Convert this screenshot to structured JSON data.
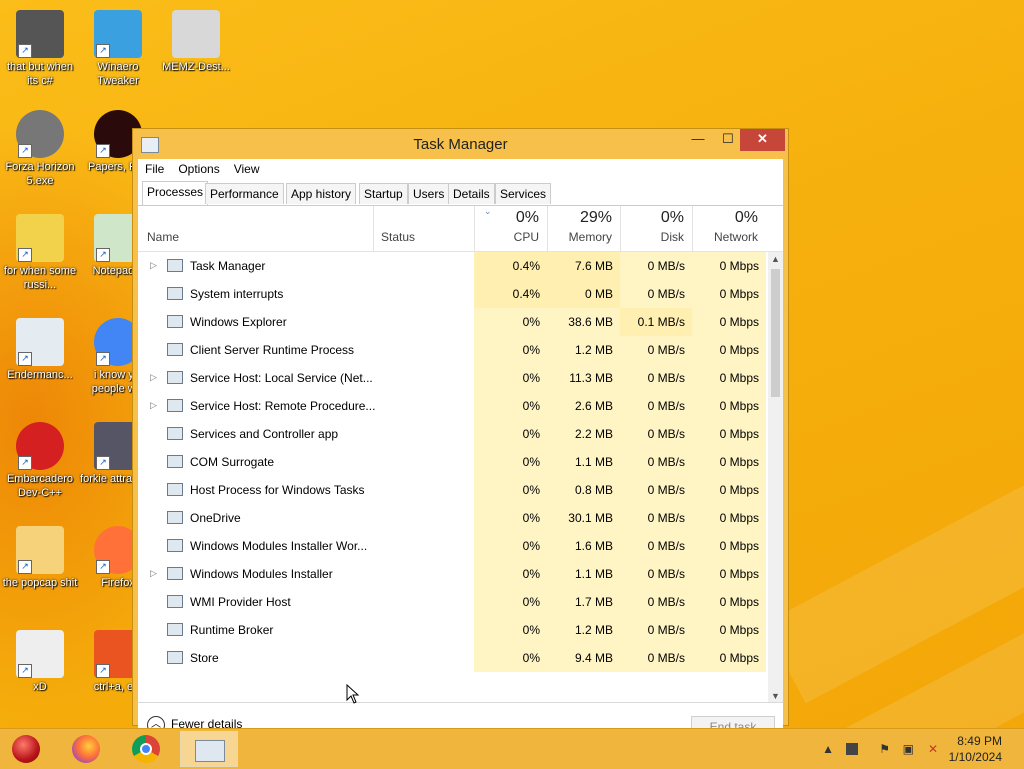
{
  "desktop": {
    "icons": [
      {
        "label": "that but when its c#",
        "icon": "stack-windows-icon"
      },
      {
        "label": "Winaero Tweaker",
        "icon": "winaero-icon"
      },
      {
        "label": "MEMZ-Dest...",
        "icon": "recycle-bin-icon"
      },
      {
        "label": "Forza Horizon 5.exe",
        "icon": "flash-icon"
      },
      {
        "label": "Papers, Pl...",
        "icon": "papers-please-icon"
      },
      {
        "label": "for when some russi...",
        "icon": "de-icon"
      },
      {
        "label": "Notepad...",
        "icon": "notepad-icon"
      },
      {
        "label": "Endermanc...",
        "icon": "window-icon"
      },
      {
        "label": "i know y... people w...",
        "icon": "chrome-icon"
      },
      {
        "label": "Embarcadero Dev-C++",
        "icon": "devcpp-icon"
      },
      {
        "label": "forkie attracta...",
        "icon": "gears-icon"
      },
      {
        "label": "the popcap shit",
        "icon": "popcap-icon"
      },
      {
        "label": "Firefox",
        "icon": "firefox-icon"
      },
      {
        "label": "xD",
        "icon": "hxd-icon"
      },
      {
        "label": "ctrl+a, e...",
        "icon": "ubuntu-icon"
      }
    ]
  },
  "window": {
    "title": "Task Manager",
    "minimize": "—",
    "maximize": "☐",
    "close": "✕",
    "menu": [
      "File",
      "Options",
      "View"
    ],
    "tabs": [
      "Processes",
      "Performance",
      "App history",
      "Startup",
      "Users",
      "Details",
      "Services"
    ],
    "active_tab": "Processes",
    "columns": {
      "name": "Name",
      "status": "Status",
      "cpu": {
        "pct": "0%",
        "label": "CPU"
      },
      "memory": {
        "pct": "29%",
        "label": "Memory"
      },
      "disk": {
        "pct": "0%",
        "label": "Disk"
      },
      "network": {
        "pct": "0%",
        "label": "Network"
      }
    },
    "processes": [
      {
        "name": "Task Manager",
        "expandable": true,
        "cpu": "0.4%",
        "memory": "7.6 MB",
        "disk": "0 MB/s",
        "network": "0 Mbps"
      },
      {
        "name": "System interrupts",
        "expandable": false,
        "cpu": "0.4%",
        "memory": "0 MB",
        "disk": "0 MB/s",
        "network": "0 Mbps"
      },
      {
        "name": "Windows Explorer",
        "expandable": false,
        "cpu": "0%",
        "memory": "38.6 MB",
        "disk": "0.1 MB/s",
        "network": "0 Mbps"
      },
      {
        "name": "Client Server Runtime Process",
        "expandable": false,
        "cpu": "0%",
        "memory": "1.2 MB",
        "disk": "0 MB/s",
        "network": "0 Mbps"
      },
      {
        "name": "Service Host: Local Service (Net...",
        "expandable": true,
        "cpu": "0%",
        "memory": "11.3 MB",
        "disk": "0 MB/s",
        "network": "0 Mbps"
      },
      {
        "name": "Service Host: Remote Procedure...",
        "expandable": true,
        "cpu": "0%",
        "memory": "2.6 MB",
        "disk": "0 MB/s",
        "network": "0 Mbps"
      },
      {
        "name": "Services and Controller app",
        "expandable": false,
        "cpu": "0%",
        "memory": "2.2 MB",
        "disk": "0 MB/s",
        "network": "0 Mbps"
      },
      {
        "name": "COM Surrogate",
        "expandable": false,
        "cpu": "0%",
        "memory": "1.1 MB",
        "disk": "0 MB/s",
        "network": "0 Mbps"
      },
      {
        "name": "Host Process for Windows Tasks",
        "expandable": false,
        "cpu": "0%",
        "memory": "0.8 MB",
        "disk": "0 MB/s",
        "network": "0 Mbps"
      },
      {
        "name": "OneDrive",
        "expandable": false,
        "cpu": "0%",
        "memory": "30.1 MB",
        "disk": "0 MB/s",
        "network": "0 Mbps"
      },
      {
        "name": "Windows Modules Installer Wor...",
        "expandable": false,
        "cpu": "0%",
        "memory": "1.6 MB",
        "disk": "0 MB/s",
        "network": "0 Mbps"
      },
      {
        "name": "Windows Modules Installer",
        "expandable": true,
        "cpu": "0%",
        "memory": "1.1 MB",
        "disk": "0 MB/s",
        "network": "0 Mbps"
      },
      {
        "name": "WMI Provider Host",
        "expandable": false,
        "cpu": "0%",
        "memory": "1.7 MB",
        "disk": "0 MB/s",
        "network": "0 Mbps"
      },
      {
        "name": "Runtime Broker",
        "expandable": false,
        "cpu": "0%",
        "memory": "1.2 MB",
        "disk": "0 MB/s",
        "network": "0 Mbps"
      },
      {
        "name": "Store",
        "expandable": false,
        "cpu": "0%",
        "memory": "9.4 MB",
        "disk": "0 MB/s",
        "network": "0 Mbps"
      }
    ],
    "footer": {
      "fewer_details": "Fewer details",
      "end_task": "End task"
    }
  },
  "taskbar": {
    "apps": [
      "start-ornament-icon",
      "firefox-icon",
      "chrome-icon",
      "task-manager-icon"
    ],
    "clock_time": "8:49 PM",
    "clock_date": "1/10/2024"
  },
  "colors": {
    "accent": "#c7463a",
    "desktop": "#f6b00d",
    "highlight": "#fff4c4"
  }
}
